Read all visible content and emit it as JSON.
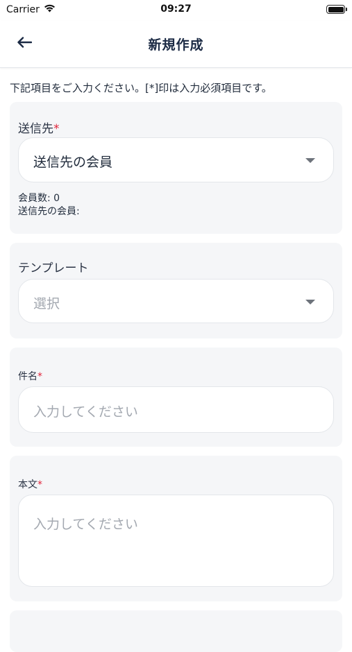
{
  "status": {
    "carrier": "Carrier",
    "time": "09:27"
  },
  "header": {
    "title": "新規作成",
    "back_icon": "arrow-left-icon"
  },
  "instruction": "下記項目をご入力ください。[*]印は入力必須項目です。",
  "recipient": {
    "label": "送信先",
    "required": "*",
    "value": "送信先の会員",
    "member_count": "会員数: 0",
    "members_label": "送信先の会員:"
  },
  "template": {
    "label": "テンプレート",
    "placeholder": "選択"
  },
  "subject": {
    "label": "件名",
    "required": "*",
    "placeholder": "入力してください"
  },
  "body": {
    "label": "本文",
    "required": "*",
    "placeholder": "入力してください"
  },
  "colors": {
    "accent": "#1b2a44",
    "required": "#e0243a",
    "card_bg": "#f5f6f8"
  }
}
